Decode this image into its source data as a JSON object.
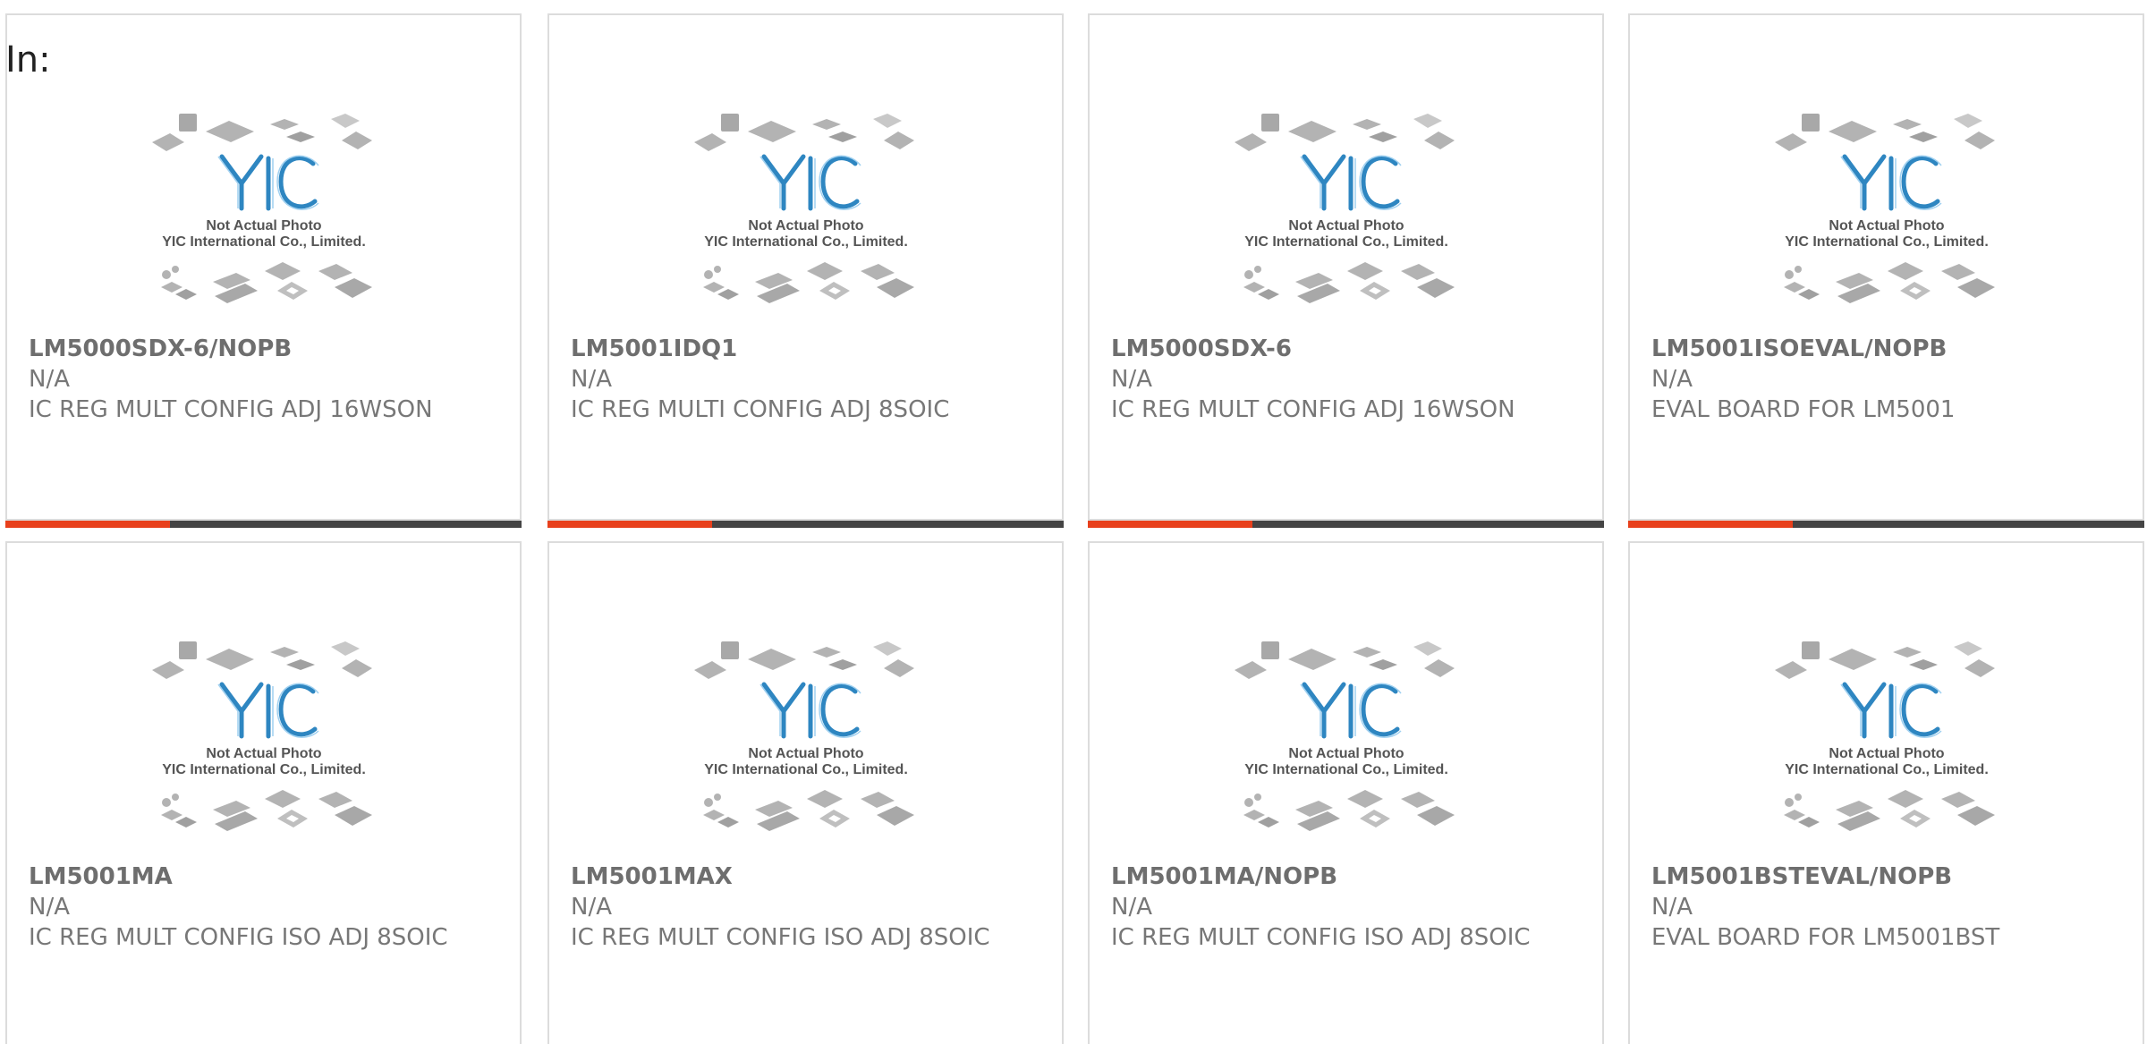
{
  "filter": {
    "label": "In:"
  },
  "accent_color": "#e8401c",
  "bar_color": "#444444",
  "placeholder": {
    "line1": "Not Actual Photo",
    "line2": "YIC International Co., Limited.",
    "logo": "YIC"
  },
  "products": [
    {
      "part": "LM5000SDX-6/NOPB",
      "mfr": "N/A",
      "desc": "IC REG MULT CONFIG ADJ 16WSON"
    },
    {
      "part": "LM5001IDQ1",
      "mfr": "N/A",
      "desc": "IC REG MULTI CONFIG ADJ 8SOIC"
    },
    {
      "part": "LM5000SDX-6",
      "mfr": "N/A",
      "desc": "IC REG MULT CONFIG ADJ 16WSON"
    },
    {
      "part": "LM5001ISOEVAL/NOPB",
      "mfr": "N/A",
      "desc": "EVAL BOARD FOR LM5001"
    },
    {
      "part": "LM5001MA",
      "mfr": "N/A",
      "desc": "IC REG MULT CONFIG ISO ADJ 8SOIC"
    },
    {
      "part": "LM5001MAX",
      "mfr": "N/A",
      "desc": "IC REG MULT CONFIG ISO ADJ 8SOIC"
    },
    {
      "part": "LM5001MA/NOPB",
      "mfr": "N/A",
      "desc": "IC REG MULT CONFIG ISO ADJ 8SOIC"
    },
    {
      "part": "LM5001BSTEVAL/NOPB",
      "mfr": "N/A",
      "desc": "EVAL BOARD FOR LM5001BST"
    }
  ]
}
